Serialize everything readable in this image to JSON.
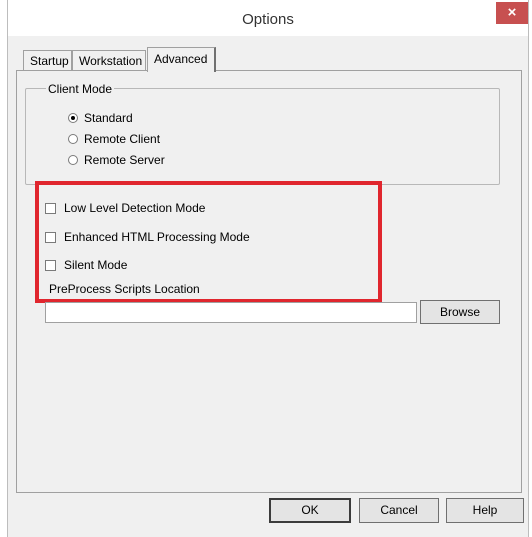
{
  "window": {
    "title": "Options",
    "close_glyph": "×"
  },
  "tabs": [
    {
      "label": "Startup"
    },
    {
      "label": "Workstation"
    },
    {
      "label": "Advanced",
      "active": true
    }
  ],
  "client_mode": {
    "legend": "Client Mode",
    "options": [
      {
        "label": "Standard",
        "selected": true
      },
      {
        "label": "Remote Client",
        "selected": false
      },
      {
        "label": "Remote Server",
        "selected": false
      }
    ]
  },
  "checkboxes": [
    {
      "label": "Low Level Detection Mode",
      "checked": false
    },
    {
      "label": "Enhanced HTML Processing Mode",
      "checked": false
    },
    {
      "label": "Silent Mode",
      "checked": false
    }
  ],
  "preprocess": {
    "label": "PreProcess Scripts Location",
    "value": "",
    "browse_label": "Browse"
  },
  "footer": {
    "ok_label": "OK",
    "cancel_label": "Cancel",
    "help_label": "Help"
  },
  "colors": {
    "highlight": "#e0262e",
    "close_button": "#c75050",
    "dialog_bg": "#f0f0f0"
  }
}
